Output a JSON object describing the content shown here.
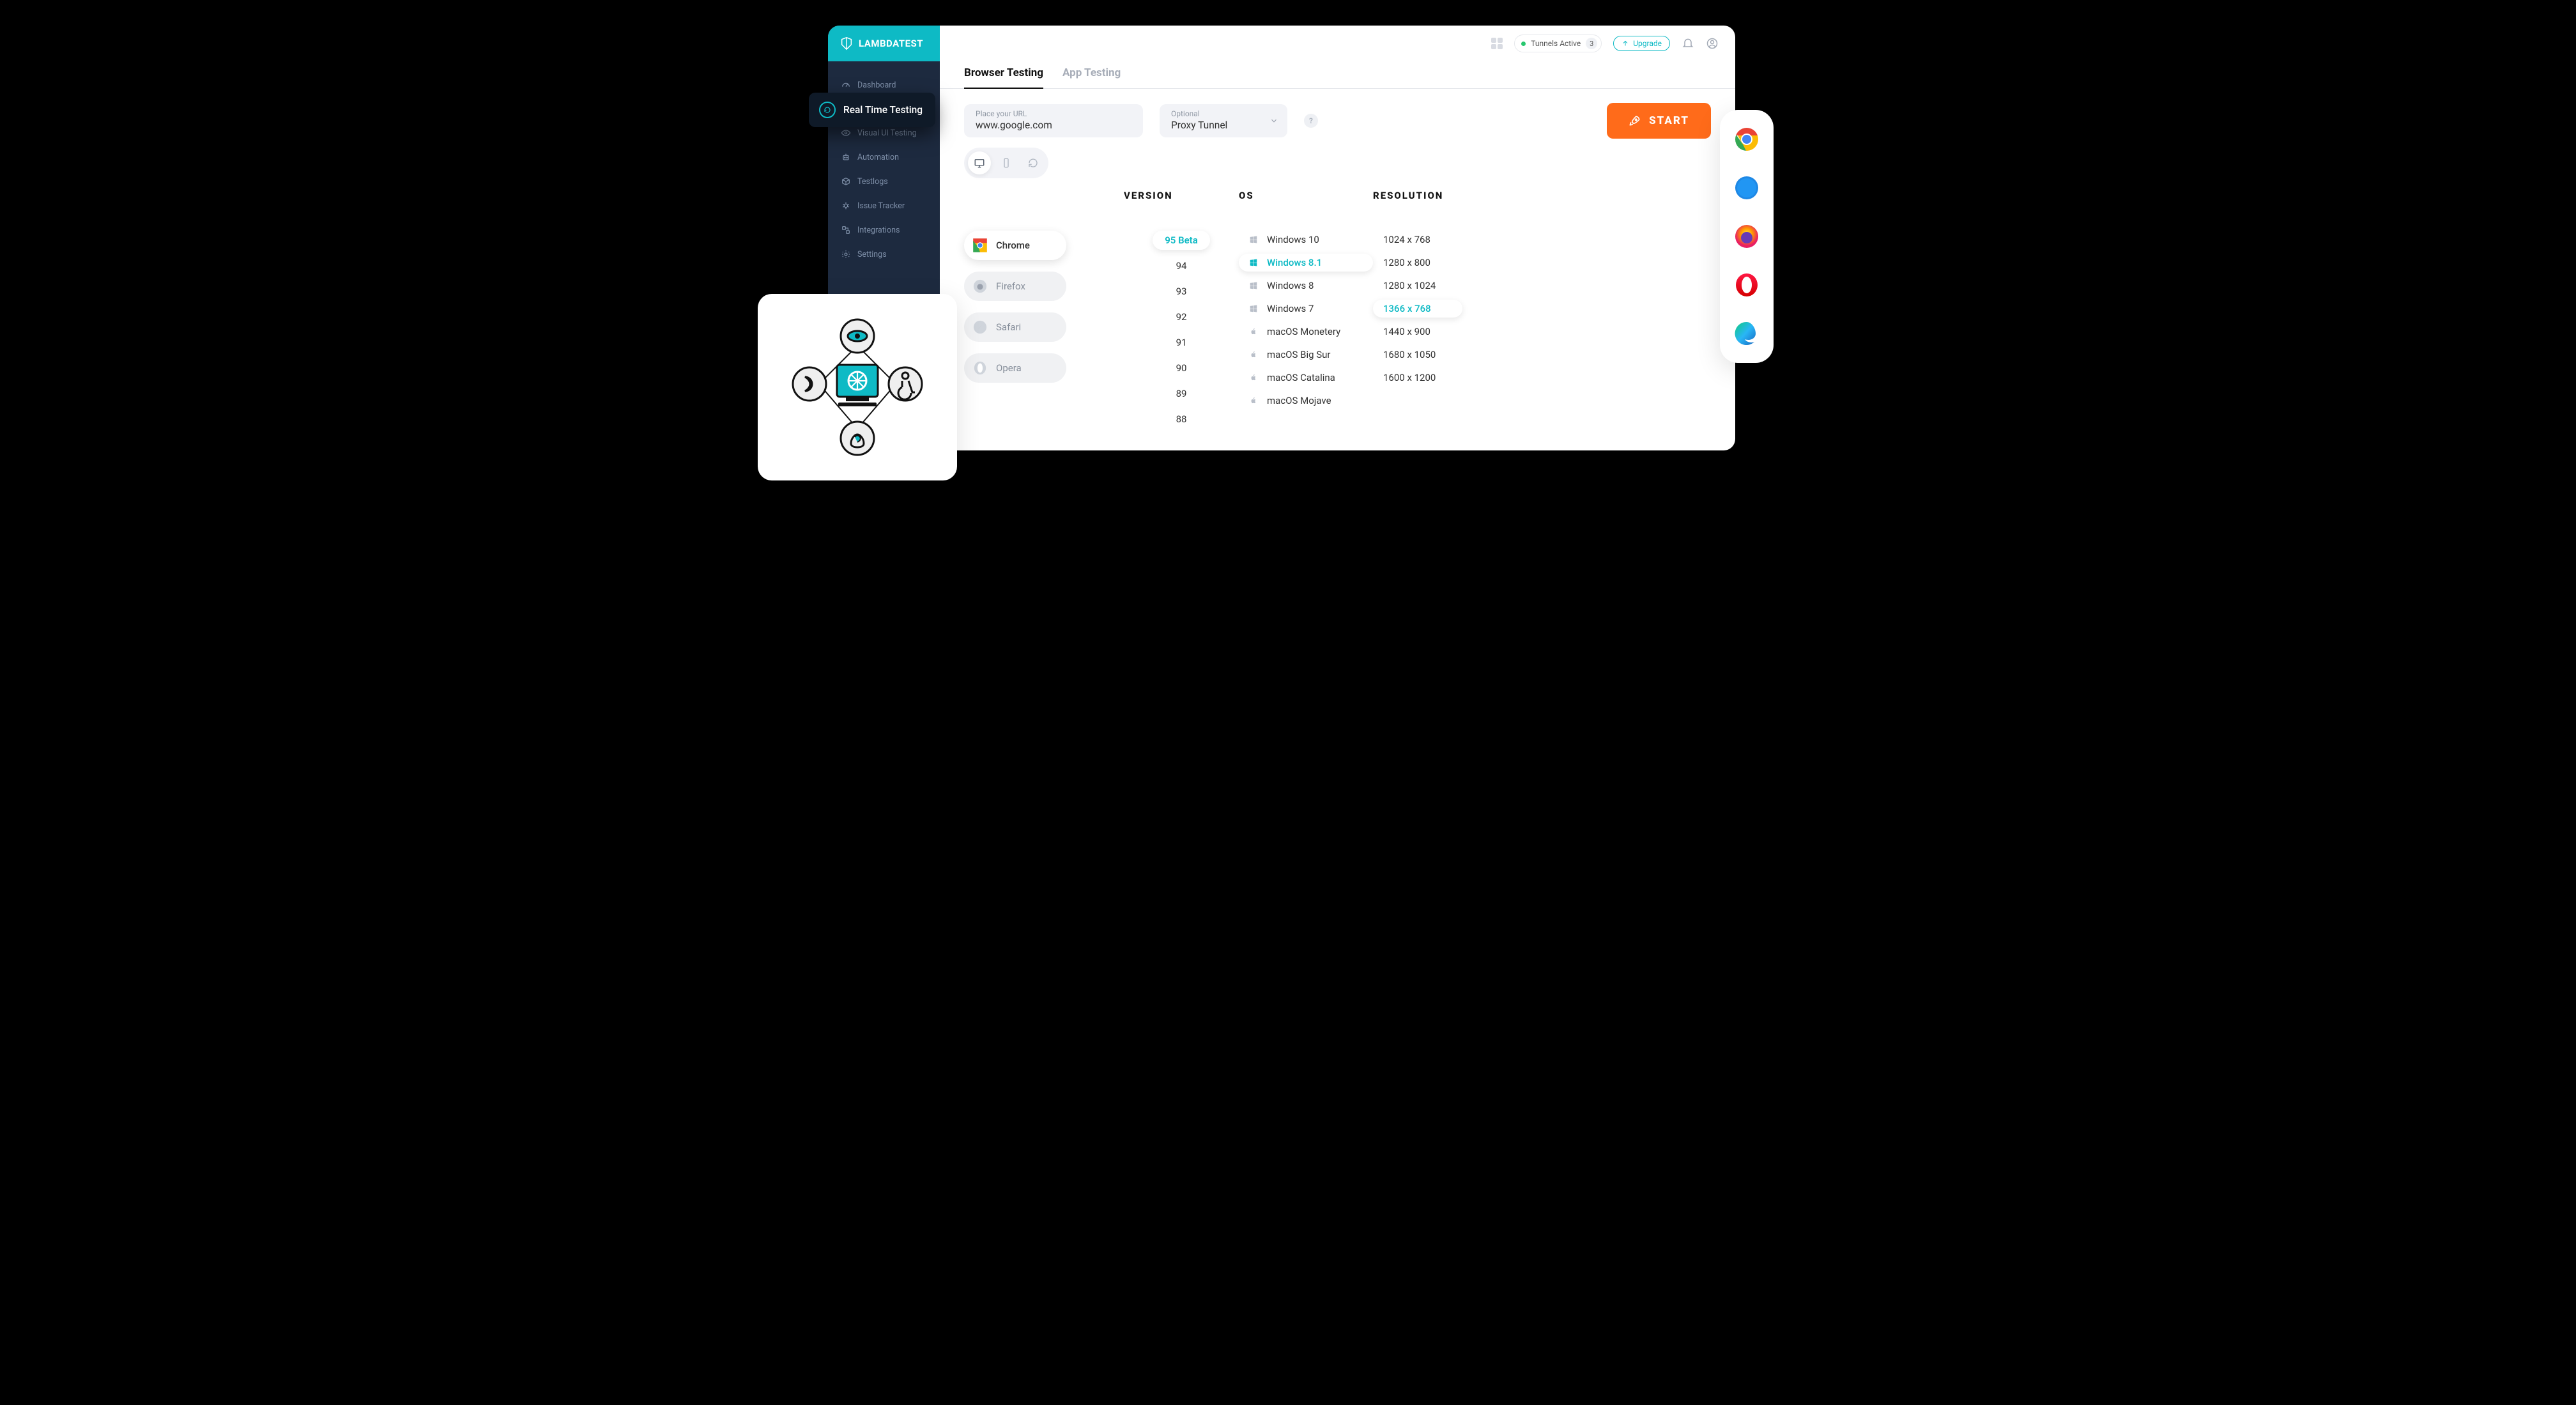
{
  "brand": "LAMBDATEST",
  "sidebar": {
    "items": [
      {
        "label": "Dashboard"
      },
      {
        "label": "Real Time Testing"
      },
      {
        "label": "Visual UI Testing"
      },
      {
        "label": "Automation"
      },
      {
        "label": "Testlogs"
      },
      {
        "label": "Issue Tracker"
      },
      {
        "label": "Integrations"
      },
      {
        "label": "Settings"
      }
    ]
  },
  "flyout": {
    "label": "Real Time Testing"
  },
  "topbar": {
    "tunnels_label": "Tunnels Active",
    "tunnels_count": "3",
    "upgrade_label": "Upgrade"
  },
  "tabs": [
    {
      "label": "Browser Testing",
      "active": true
    },
    {
      "label": "App Testing",
      "active": false
    }
  ],
  "url_field": {
    "placeholder": "Place your URL",
    "value": "www.google.com"
  },
  "proxy_field": {
    "placeholder": "Optional",
    "value": "Proxy Tunnel"
  },
  "start_label": "START",
  "columns": {
    "version": "VERSION",
    "os": "OS",
    "resolution": "RESOLUTION"
  },
  "browsers": [
    {
      "label": "Chrome",
      "active": true
    },
    {
      "label": "Firefox",
      "active": false
    },
    {
      "label": "Safari",
      "active": false
    },
    {
      "label": "Opera",
      "active": false
    }
  ],
  "versions": [
    "95 Beta",
    "94",
    "93",
    "92",
    "91",
    "90",
    "89",
    "88"
  ],
  "version_selected": "95 Beta",
  "oses": [
    {
      "label": "Windows 10",
      "platform": "windows"
    },
    {
      "label": "Windows 8.1",
      "platform": "windows",
      "selected": true
    },
    {
      "label": "Windows 8",
      "platform": "windows"
    },
    {
      "label": "Windows 7",
      "platform": "windows"
    },
    {
      "label": "macOS Monetery",
      "platform": "mac"
    },
    {
      "label": "macOS Big Sur",
      "platform": "mac"
    },
    {
      "label": "macOS Catalina",
      "platform": "mac"
    },
    {
      "label": "macOS Mojave",
      "platform": "mac"
    }
  ],
  "resolutions": [
    "1024 x 768",
    "1280 x 800",
    "1280 x 1024",
    "1366 x 768",
    "1440 x 900",
    "1680 x 1050",
    "1600 x 1200"
  ],
  "resolution_selected": "1366 x 768",
  "browser_card": [
    "chrome",
    "safari",
    "firefox",
    "opera",
    "edge"
  ]
}
